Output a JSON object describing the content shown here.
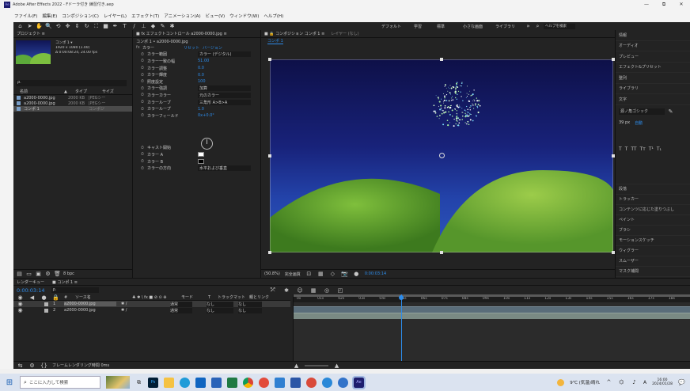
{
  "window": {
    "title": "Adobe After Effects 2022 - Fドーラ付き 練習付き.aep",
    "controls": [
      "—",
      "⧉",
      "✕"
    ]
  },
  "menu": [
    "ファイル(F)",
    "編集(E)",
    "コンポジション(C)",
    "レイヤー(L)",
    "エフェクト(T)",
    "アニメーション(A)",
    "ビュー(V)",
    "ウィンドウ(W)",
    "ヘルプ(H)"
  ],
  "toolbar": {
    "workspaces": [
      "デフォルト",
      "学習",
      "標準",
      "小さな画面",
      "ライブラリ"
    ],
    "search_placeholder": "ヘルプを検索"
  },
  "project": {
    "tab": "プロジェクト ≡",
    "thumb_info": [
      "コンポ 1 ▾",
      "1920 x 1080 (1.00)",
      "Δ 0:00:08:24, 24.00 fps"
    ],
    "search": "ρ.",
    "headers": [
      "名前",
      "▲",
      "タイプ",
      "サイズ"
    ],
    "items": [
      {
        "name": "a2000-0000.jpg",
        "size": "2000 KB",
        "type": "JPEGシー"
      },
      {
        "name": "a2000-0000.jpg",
        "size": "2000 KB",
        "type": "JPEGシー"
      },
      {
        "name": "コンポ 1",
        "size": "",
        "type": "コンポジ"
      }
    ],
    "footer": "8 bpc"
  },
  "effects": {
    "tab": "■ fx エフェクトコントロール a2000-0000.jpg ≡",
    "subtitle": "コンポ 1 • a2000-0000.jpg",
    "header": {
      "name": "カラー",
      "reset": "リセット",
      "about": "バージョン"
    },
    "props": [
      {
        "name": "カラー範囲",
        "value": "カラー (デジタル)"
      },
      {
        "name": "カラー一致の幅",
        "value": "51.00"
      },
      {
        "name": "カラー調整",
        "value": "0.0"
      },
      {
        "name": "カラー輝度",
        "value": "0.0"
      },
      {
        "name": "照度設定",
        "value": "100"
      },
      {
        "name": "カラー強調",
        "value": "加算"
      },
      {
        "name": "カラーカラー",
        "value": "元のカラー"
      },
      {
        "name": "カラーループ",
        "value": "三角形 A>B>A"
      },
      {
        "name": "カラーループ",
        "value": "1.0"
      },
      {
        "name": "カラーフィールド",
        "value": "0x+0.0°"
      },
      {
        "name": "キャスト開始",
        "value": ""
      },
      {
        "name": "カラー A",
        "value": ""
      },
      {
        "name": "カラー B",
        "value": ""
      },
      {
        "name": "カラーの方向",
        "value": "水平および垂直"
      }
    ]
  },
  "viewer": {
    "tabs": [
      "■ 🔒 コンポジション コンポ 1 ≡",
      "レイヤー (なし)"
    ],
    "comp_label": "コンポ 1",
    "footer": [
      "(50.8%)",
      "完全画質",
      "0:00:03:14"
    ]
  },
  "right_panel": {
    "items": [
      "情報",
      "オーディオ",
      "プレビュー",
      "エフェクト&プリセット",
      "整列",
      "ライブラリ",
      "文字"
    ],
    "char_font": "源ノ角ゴシック",
    "char_size": "39 px",
    "char_leading": "自動",
    "lower_items": [
      "段落",
      "トラッカー",
      "コンテンツに応じた塗りつぶし",
      "ペイント",
      "ブラシ",
      "モーションスケッチ",
      "ウィグラー",
      "スムーザー",
      "マスク補間"
    ]
  },
  "timeline": {
    "tabs": [
      "レンダーキュー",
      "■ コンポ 1 ≡"
    ],
    "timecode": "0:00:03:14",
    "search": "ρ.",
    "headers": [
      "#",
      "ソース名",
      "♣ ✱ \\ fx ■ ⊘ ⊙ ⊕",
      "モード",
      "T",
      "トラックマット",
      "親とリンク"
    ],
    "layers": [
      {
        "num": "1",
        "name": "a2000-0000.jpg",
        "mode": "通常",
        "matte": "なし",
        "parent": "なし"
      },
      {
        "num": "2",
        "name": "a2000-0000.jpg",
        "mode": "通常",
        "matte": "なし",
        "parent": "なし"
      }
    ],
    "ruler": [
      "0s",
      "01s",
      "02s",
      "03s",
      "04s",
      "05s",
      "06s",
      "07s",
      "08s",
      "09s",
      "10s",
      "11s",
      "12s",
      "13s",
      "14s",
      "15s",
      "16s",
      "17s",
      "18s"
    ],
    "footer": "フレームレンダリング時間 0ms",
    "playhead_fraction": 0.27
  },
  "taskbar": {
    "search_placeholder": "ここに入力して検索",
    "weather": "9℃ (気温)晴れ",
    "ime": "A",
    "time": "16:00",
    "date": "2024/01/28"
  },
  "colors": {
    "accent": "#2d8ceb",
    "panel": "#232323",
    "timecode": "#2d8ceb"
  }
}
